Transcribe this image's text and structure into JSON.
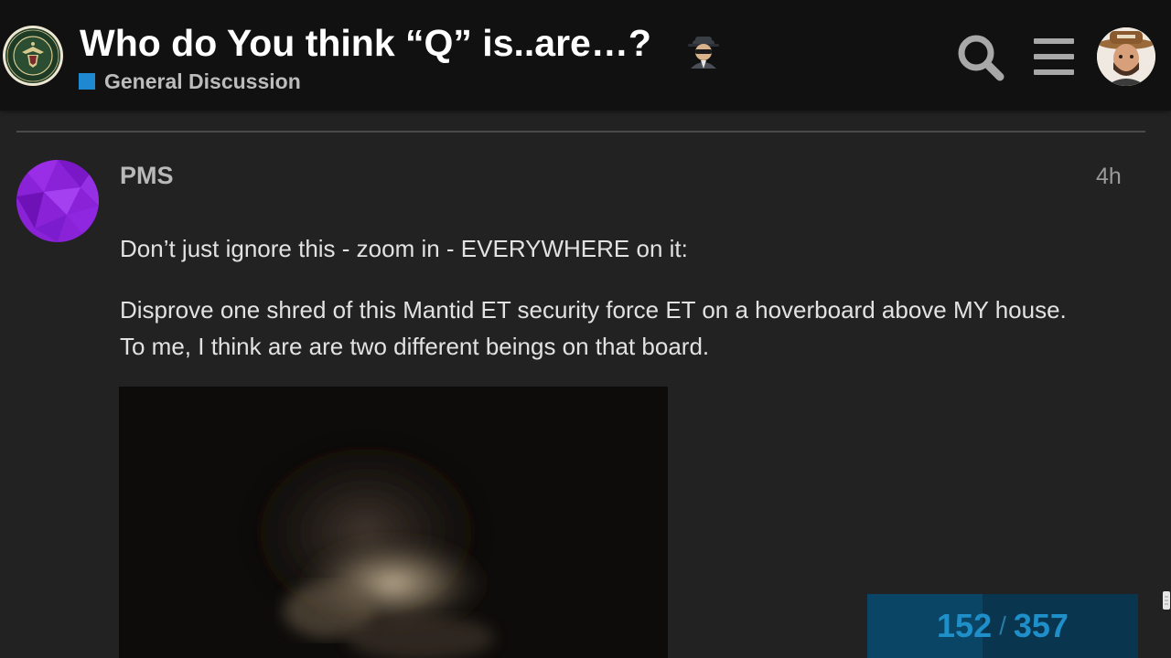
{
  "header": {
    "title": "Who do You think “Q” is..are…?",
    "title_emoji": "spy-emoji",
    "category": {
      "name": "General Discussion",
      "color": "#1e88d1"
    },
    "icons": {
      "search": "search-icon",
      "menu": "hamburger-menu-icon",
      "avatar": "user-avatar"
    }
  },
  "post": {
    "username": "PMS",
    "date": "4h",
    "paragraphs": [
      "Don’t just ignore this - zoom in - EVERYWHERE on it:",
      "Disprove one shred of this Mantid ET security force ET on a hoverboard above MY house. To me, I think are are two different beings on that board."
    ]
  },
  "progress": {
    "current": "152",
    "separator": "/",
    "total": "357",
    "fraction": 0.4258
  },
  "colors": {
    "background": "#222222",
    "header": "#111111",
    "accent": "#1e88d1",
    "progress_bg": "#09354f"
  }
}
